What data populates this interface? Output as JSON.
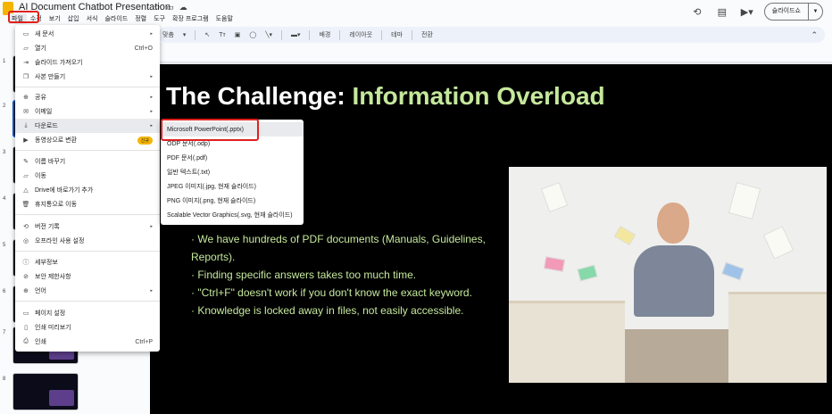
{
  "app": {
    "title": "AI Document Chatbot Presentation",
    "title_icons": [
      "star-icon",
      "move-to-folder-icon",
      "cloud-status-icon"
    ]
  },
  "menubar": [
    "파일",
    "수정",
    "보기",
    "삽입",
    "서식",
    "슬라이드",
    "정렬",
    "도구",
    "확장 프로그램",
    "도움말"
  ],
  "header_right": {
    "slideshow_label": "슬라이드쇼"
  },
  "toolbar": {
    "fit_label": "맞춤",
    "text_tool": "Tт",
    "background": "배경",
    "layout": "레이아웃",
    "theme": "테마",
    "transition": "전환"
  },
  "filmstrip": {
    "slide_numbers": [
      "1",
      "2",
      "3",
      "4",
      "5",
      "6",
      "7",
      "8"
    ]
  },
  "file_menu": {
    "items": [
      {
        "icon": "new-doc-icon",
        "label": "새 문서",
        "shortcut": "",
        "arrow": true
      },
      {
        "icon": "folder-open-icon",
        "label": "열기",
        "shortcut": "Ctrl+O"
      },
      {
        "icon": "import-slides-icon",
        "label": "슬라이드 가져오기",
        "shortcut": ""
      },
      {
        "icon": "copy-icon",
        "label": "사본 만들기",
        "shortcut": "",
        "arrow": true
      },
      {
        "icon": "share-icon",
        "label": "공유",
        "shortcut": "",
        "arrow": true
      },
      {
        "icon": "email-icon",
        "label": "이메일",
        "shortcut": "",
        "arrow": true
      },
      {
        "icon": "download-icon",
        "label": "다운로드",
        "shortcut": "",
        "arrow": true
      },
      {
        "icon": "video-convert-icon",
        "label": "동영상으로 변환",
        "badge": "신규"
      },
      {
        "icon": "rename-icon",
        "label": "이름 바꾸기",
        "shortcut": ""
      },
      {
        "icon": "move-icon",
        "label": "이동",
        "shortcut": ""
      },
      {
        "icon": "drive-shortcut-icon",
        "label": "Drive에 바로가기 추가",
        "shortcut": ""
      },
      {
        "icon": "trash-icon",
        "label": "휴지통으로 이동",
        "shortcut": ""
      },
      {
        "icon": "history-icon",
        "label": "버전 기록",
        "shortcut": "",
        "arrow": true
      },
      {
        "icon": "offline-icon",
        "label": "오프라인 사용 설정",
        "shortcut": ""
      },
      {
        "icon": "info-icon",
        "label": "세부정보",
        "shortcut": ""
      },
      {
        "icon": "security-icon",
        "label": "보안 제한사항",
        "shortcut": ""
      },
      {
        "icon": "globe-icon",
        "label": "언어",
        "shortcut": "",
        "arrow": true
      },
      {
        "icon": "page-setup-icon",
        "label": "페이지 설정",
        "shortcut": ""
      },
      {
        "icon": "print-preview-icon",
        "label": "인쇄 미리보기",
        "shortcut": ""
      },
      {
        "icon": "print-icon",
        "label": "인쇄",
        "shortcut": "Ctrl+P"
      }
    ]
  },
  "download_menu": {
    "items": [
      "Microsoft PowerPoint(.pptx)",
      "ODP 문서(.odp)",
      "PDF 문서(.pdf)",
      "일반 텍스트(.txt)",
      "JPEG 이미지(.jpg, 현재 슬라이드)",
      "PNG 이미지(.png, 현재 슬라이드)",
      "Scalable Vector Graphics(.svg, 현재 슬라이드)"
    ]
  },
  "slide": {
    "title_part1": "The Challenge: ",
    "title_part2": "Information Overload",
    "bullets": [
      "· We have hundreds of PDF documents (Manuals, Guidelines,",
      "Reports).",
      "· Finding specific answers takes too much time.",
      "· \"Ctrl+F\" doesn't work if you don't know the exact keyword.",
      "· Knowledge is locked away in files, not easily accessible."
    ]
  },
  "colors": {
    "accent_green": "#c5e89c",
    "slide_bg": "#000000",
    "annotation_red": "#e0201e",
    "selection_blue": "#0b57d0"
  }
}
